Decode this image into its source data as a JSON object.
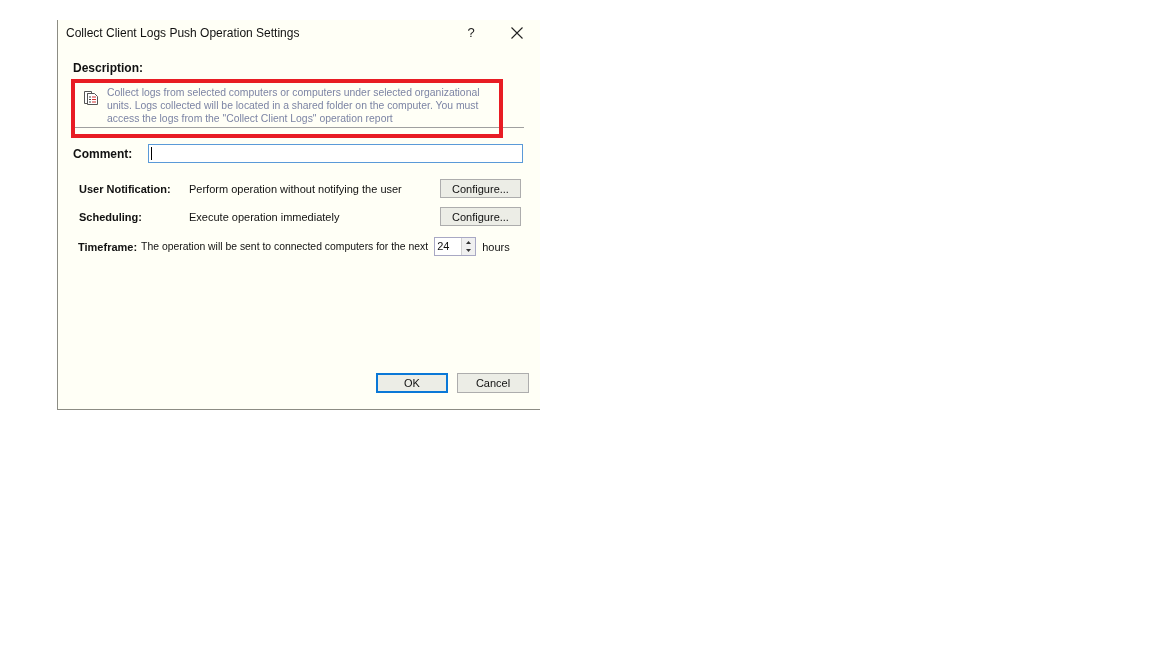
{
  "window": {
    "title": "Collect Client Logs Push Operation Settings",
    "help_button": "?"
  },
  "description": {
    "label": "Description:",
    "text": "Collect logs from selected computers or computers under selected organizational units. Logs collected will be located in a shared folder on the computer. You must access the logs from the \"Collect Client Logs\" operation report",
    "highlighted": true
  },
  "comment": {
    "label": "Comment:",
    "focused": true
  },
  "settings": [
    {
      "label": "User Notification:",
      "value": "Perform operation without notifying the user",
      "button": "Configure..."
    },
    {
      "label": "Scheduling:",
      "value": "Execute operation immediately",
      "button": "Configure..."
    }
  ],
  "timeframe": {
    "label": "Timeframe:",
    "text": "The operation will be sent to connected computers for the next",
    "value": "24",
    "unit": "hours"
  },
  "buttons": [
    {
      "label": "OK",
      "default": true
    },
    {
      "label": "Cancel",
      "default": false
    }
  ]
}
